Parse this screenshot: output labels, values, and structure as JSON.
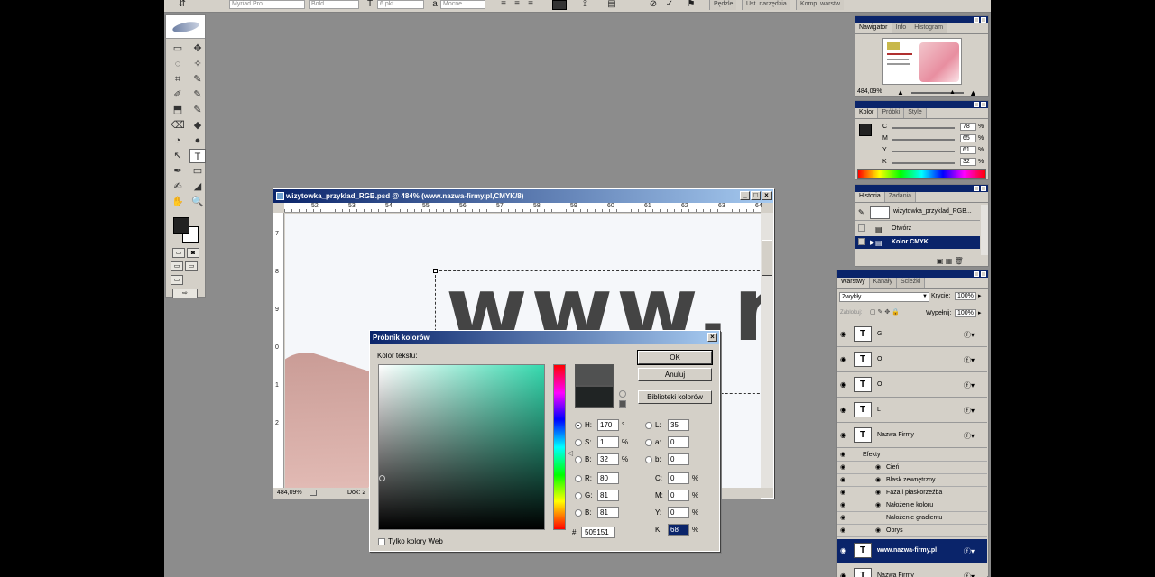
{
  "options_bar": {
    "font_family": "Myriad Pro",
    "font_style": "Bold",
    "font_size": "6 pkt",
    "antialias_prefix": "a",
    "antialias": "Mocne",
    "tabs": [
      "Pędzle",
      "Ust. narzędzia",
      "Komp. warstw"
    ]
  },
  "toolbox": {
    "tools": [
      "▭",
      "✥",
      "◌",
      "✧",
      "⌗",
      "✎",
      "✐",
      "✎",
      "⬒",
      "✎",
      "⌫",
      "◆",
      "◔",
      "●",
      "↖",
      "T",
      "✒",
      "▭",
      "✍",
      "◢",
      "✋",
      "🔍"
    ]
  },
  "document": {
    "title": "wizytowka_przyklad_RGB.psd @ 484% (www.nazwa-firmy.pl,CMYK/8)",
    "ruler_top_labels": [
      "52",
      "53",
      "54",
      "55",
      "56",
      "57",
      "58",
      "59",
      "60",
      "61",
      "62",
      "63",
      "64"
    ],
    "ruler_left_labels": [
      "7",
      "8",
      "9",
      "0",
      "1",
      "2"
    ],
    "canvas_text": "www.n",
    "zoom": "484,09%",
    "status": "Dok: 2"
  },
  "navigator": {
    "tabs": [
      "Nawigator",
      "Info",
      "Histogram"
    ],
    "zoom": "484,09%"
  },
  "color_panel": {
    "tabs": [
      "Kolor",
      "Próbki",
      "Style"
    ],
    "channels": [
      {
        "label": "C",
        "value": "78",
        "unit": "%"
      },
      {
        "label": "M",
        "value": "65",
        "unit": "%"
      },
      {
        "label": "Y",
        "value": "61",
        "unit": "%"
      },
      {
        "label": "K",
        "value": "32",
        "unit": "%"
      }
    ]
  },
  "history_panel": {
    "tabs": [
      "Historia",
      "Zadania"
    ],
    "snapshot": "wizytowka_przyklad_RGB...",
    "items": [
      "Otwórz",
      "Kolor CMYK"
    ]
  },
  "layers_panel": {
    "tabs": [
      "Warstwy",
      "Kanały",
      "Ścieżki"
    ],
    "blend_mode": "Zwykły",
    "opacity_label": "Krycie:",
    "opacity": "100%",
    "lock_label": "Zablokuj:",
    "fill_label": "Wypełnij:",
    "fill": "100%",
    "layers": [
      {
        "name": "G",
        "selected": false
      },
      {
        "name": "O",
        "selected": false
      },
      {
        "name": "O",
        "selected": false
      },
      {
        "name": "L",
        "selected": false
      },
      {
        "name": "Nazwa Firmy",
        "selected": false
      }
    ],
    "effects_header": "Efekty",
    "effects": [
      "Cień",
      "Blask zewnętrzny",
      "Faza i płaskorzeźba",
      "Nałożenie koloru",
      "Nałożenie gradientu",
      "Obrys"
    ],
    "selected_layer": "www.nazwa-firmy.pl",
    "bottom_layer": "Nazwa Firmy"
  },
  "color_picker": {
    "title": "Próbnik kolorów",
    "subtitle": "Kolor tekstu:",
    "ok": "OK",
    "cancel": "Anuluj",
    "libraries": "Biblioteki kolorów",
    "hsb": [
      {
        "label": "H:",
        "value": "170",
        "unit": "°",
        "checked": true
      },
      {
        "label": "S:",
        "value": "1",
        "unit": "%",
        "checked": false
      },
      {
        "label": "B:",
        "value": "32",
        "unit": "%",
        "checked": false
      }
    ],
    "rgb": [
      {
        "label": "R:",
        "value": "80",
        "checked": false
      },
      {
        "label": "G:",
        "value": "81",
        "checked": false
      },
      {
        "label": "B:",
        "value": "81",
        "checked": false
      }
    ],
    "lab": [
      {
        "label": "L:",
        "value": "35"
      },
      {
        "label": "a:",
        "value": "0"
      },
      {
        "label": "b:",
        "value": "0"
      }
    ],
    "cmyk": [
      {
        "label": "C:",
        "value": "0",
        "unit": "%"
      },
      {
        "label": "M:",
        "value": "0",
        "unit": "%"
      },
      {
        "label": "Y:",
        "value": "0",
        "unit": "%"
      },
      {
        "label": "K:",
        "value": "68",
        "unit": "%"
      }
    ],
    "hex_prefix": "#",
    "hex": "505151",
    "web_only": "Tylko kolory Web",
    "new_color": "#505151",
    "old_color": "#202424"
  }
}
